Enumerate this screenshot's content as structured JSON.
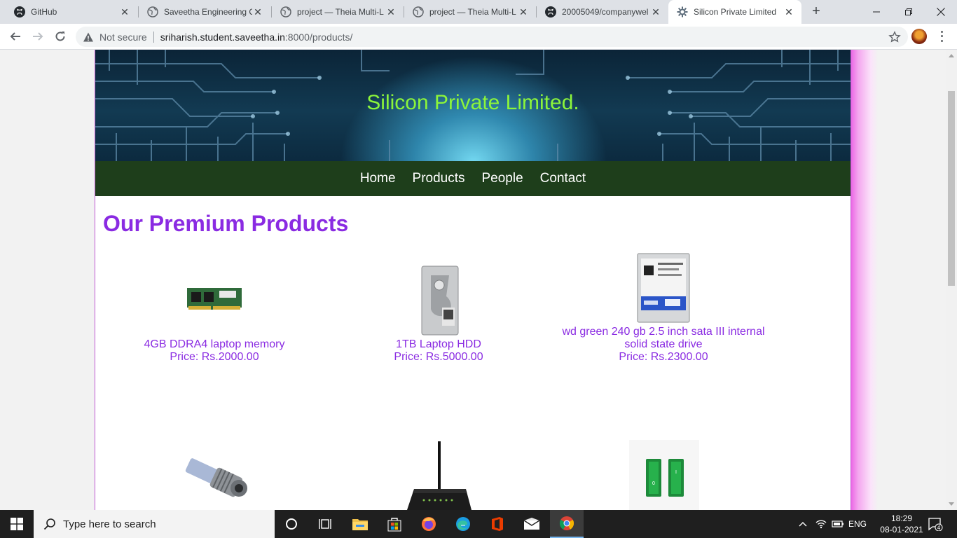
{
  "browser": {
    "tabs": [
      {
        "title": "GitHub",
        "icon": "github-icon"
      },
      {
        "title": "Saveetha Engineering C",
        "icon": "globe-icon"
      },
      {
        "title": "project — Theia Multi-L",
        "icon": "globe-icon"
      },
      {
        "title": "project — Theia Multi-L",
        "icon": "globe-icon"
      },
      {
        "title": "20005049/companywel",
        "icon": "github-icon"
      },
      {
        "title": "Silicon Private Limited",
        "icon": "gear-favicon-icon",
        "active": true
      }
    ],
    "security_label": "Not secure",
    "url_host": "sriharish.student.saveetha.in",
    "url_path": ":8000/products/"
  },
  "site": {
    "banner_title": "Silicon Private Limited.",
    "nav": [
      "Home",
      "Products",
      "People",
      "Contact"
    ],
    "page_title": "Our Premium Products",
    "products": [
      {
        "name": "4GB DDRA4 laptop memory",
        "price": "Price: Rs.2000.00",
        "image": "ram-stick"
      },
      {
        "name": "1TB Laptop HDD",
        "price": "Price: Rs.5000.00",
        "image": "laptop-hdd"
      },
      {
        "name_line1": "wd green 240 gb 2.5 inch sata III internal",
        "name_line2": "solid state drive",
        "price": "Price: Rs.2300.00",
        "image": "wd-drive"
      }
    ],
    "products_row2": [
      {
        "image": "proximity-sensor"
      },
      {
        "image": "wifi-router"
      },
      {
        "image": "rocker-switches"
      }
    ],
    "colors": {
      "accent": "#8a2be2",
      "nav_bg": "#1e3e1b",
      "banner_text": "#8cf53a",
      "side_band": "#e95ce3"
    }
  },
  "taskbar": {
    "search_placeholder": "Type here to search",
    "language": "ENG",
    "time": "18:29",
    "date": "08-01-2021",
    "notifications": "4"
  }
}
